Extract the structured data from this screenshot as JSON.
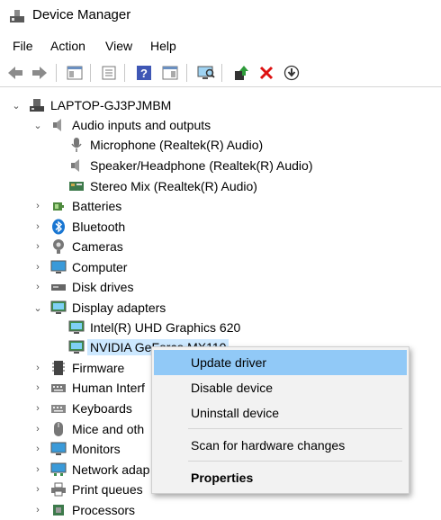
{
  "window": {
    "title": "Device Manager"
  },
  "menu": [
    "File",
    "Action",
    "View",
    "Help"
  ],
  "toolbar": {
    "buttons": [
      "back-icon",
      "forward-icon",
      "show-hide-tree-icon",
      "properties-icon",
      "help-icon",
      "view-icon",
      "scan-monitor-icon",
      "update-driver-icon",
      "uninstall-icon",
      "download-icon"
    ]
  },
  "tree": {
    "root": "LAPTOP-GJ3PJMBM",
    "audio": {
      "label": "Audio inputs and outputs",
      "children": [
        "Microphone (Realtek(R) Audio)",
        "Speaker/Headphone (Realtek(R) Audio)",
        "Stereo Mix (Realtek(R) Audio)"
      ]
    },
    "categories_a": [
      "Batteries",
      "Bluetooth",
      "Cameras",
      "Computer",
      "Disk drives"
    ],
    "display": {
      "label": "Display adapters",
      "children": [
        "Intel(R) UHD Graphics 620",
        "NVIDIA GeForce MX110"
      ]
    },
    "categories_b": [
      "Firmware",
      "Human Interf",
      "Keyboards",
      "Mice and oth",
      "Monitors",
      "Network adap",
      "Print queues",
      "Processors"
    ]
  },
  "context_menu": {
    "items": [
      "Update driver",
      "Disable device",
      "Uninstall device",
      "Scan for hardware changes",
      "Properties"
    ]
  },
  "colors": {
    "highlight": "#91c9f7",
    "selection": "#cce8ff",
    "menu_bg": "#f2f2f2"
  }
}
